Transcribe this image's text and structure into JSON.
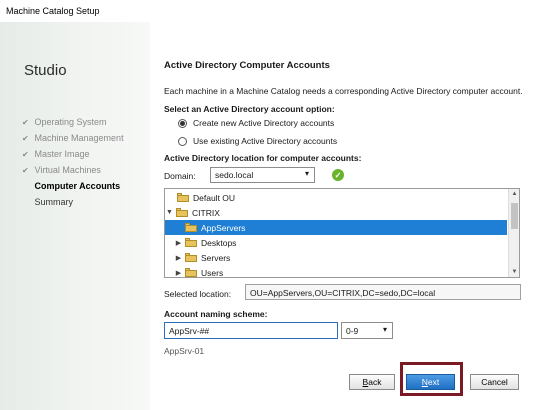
{
  "window": {
    "title": "Machine Catalog Setup"
  },
  "sidebar": {
    "product": "Studio",
    "steps": [
      {
        "label": "Operating System",
        "state": "completed"
      },
      {
        "label": "Machine Management",
        "state": "completed"
      },
      {
        "label": "Master Image",
        "state": "completed"
      },
      {
        "label": "Virtual Machines",
        "state": "completed"
      },
      {
        "label": "Computer Accounts",
        "state": "current"
      },
      {
        "label": "Summary",
        "state": "pending"
      }
    ]
  },
  "main": {
    "heading": "Active Directory Computer Accounts",
    "description": "Each machine in a Machine Catalog needs a corresponding Active Directory computer account.",
    "option_label": "Select an Active Directory account option:",
    "options": [
      {
        "label": "Create new Active Directory accounts",
        "selected": true
      },
      {
        "label": "Use existing Active Directory accounts",
        "selected": false
      }
    ],
    "location_label": "Active Directory location for computer accounts:",
    "domain_label": "Domain:",
    "domain_value": "sedo.local",
    "domain_status_icon": "check-icon",
    "tree": [
      {
        "label": "Default OU",
        "expander": ""
      },
      {
        "label": "CITRIX",
        "expander": "▼"
      },
      {
        "label": "AppServers",
        "expander": "",
        "selected": true
      },
      {
        "label": "Desktops",
        "expander": "▶"
      },
      {
        "label": "Servers",
        "expander": "▶"
      },
      {
        "label": "Users",
        "expander": "▶"
      }
    ],
    "selected_location_label": "Selected location:",
    "selected_location_value": "OU=AppServers,OU=CITRIX,DC=sedo,DC=local",
    "naming_label": "Account naming scheme:",
    "naming_value": "AppSrv-##",
    "naming_type": "0-9",
    "naming_preview": "AppSrv-01"
  },
  "buttons": {
    "back_prefix": "",
    "back_accel": "B",
    "back_rest": "ack",
    "next_accel": "N",
    "next_rest": "ext",
    "cancel": "Cancel"
  },
  "colors": {
    "selection": "#1e7fd4",
    "next_button": "#1f6fc4",
    "highlight_box": "#7a1a24",
    "ok": "#6ab42d"
  }
}
